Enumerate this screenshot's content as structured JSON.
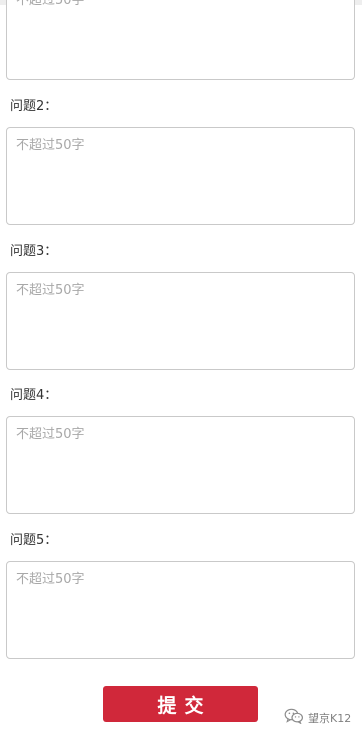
{
  "form": {
    "placeholder": "不超过50字",
    "questions": [
      {
        "label": ""
      },
      {
        "label": "问题2："
      },
      {
        "label": "问题3："
      },
      {
        "label": "问题4："
      },
      {
        "label": "问题5："
      }
    ]
  },
  "submit": {
    "label": "提交"
  },
  "watermark": {
    "text": "望京K12",
    "icon": "wechat-icon"
  },
  "colors": {
    "accent": "#d0283a",
    "border": "#c9c9c9",
    "placeholder": "#a8a8a8"
  }
}
